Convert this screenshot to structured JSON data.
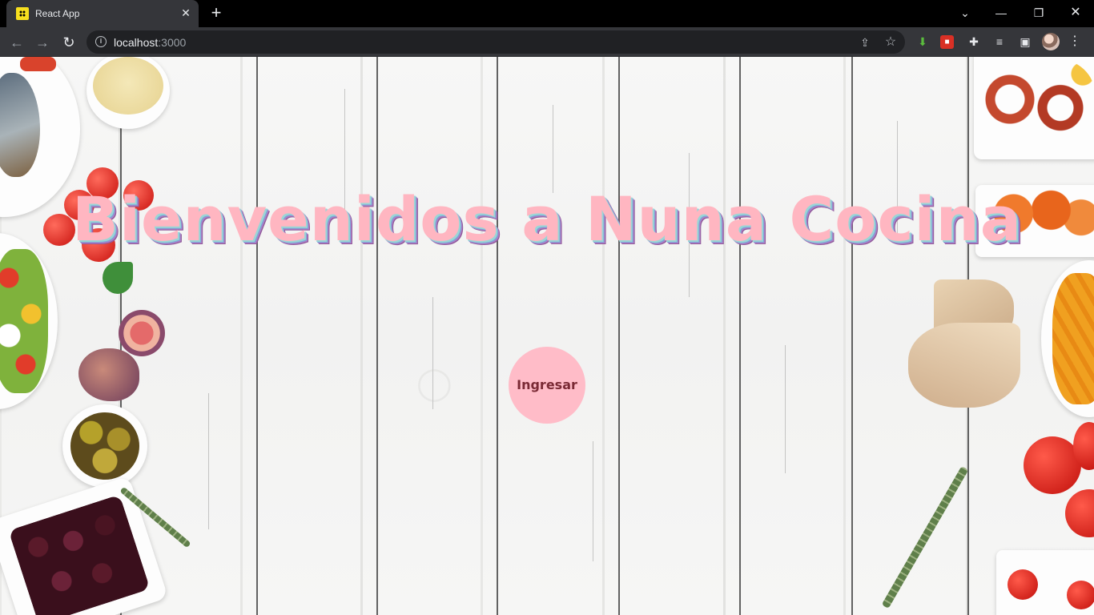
{
  "browser": {
    "tab_title": "React App",
    "url_host": "localhost",
    "url_port": ":3000"
  },
  "icons": {
    "favicon": "react-app-favicon",
    "back": "arrow-left-icon",
    "forward": "arrow-right-icon",
    "reload": "reload-icon",
    "info": "info-icon",
    "share": "share-icon",
    "bookmark": "star-icon",
    "extensions": "puzzle-icon",
    "media": "media-control-icon",
    "side_panel": "side-panel-icon",
    "menu": "kebab-menu-icon"
  },
  "page": {
    "headline": "Bienvenidos a Nuna Cocina",
    "enter_button": "Ingresar"
  },
  "colors": {
    "headline": "#ffb6c1",
    "button_bg": "#ffbcc8",
    "button_text": "#7a2a35"
  }
}
